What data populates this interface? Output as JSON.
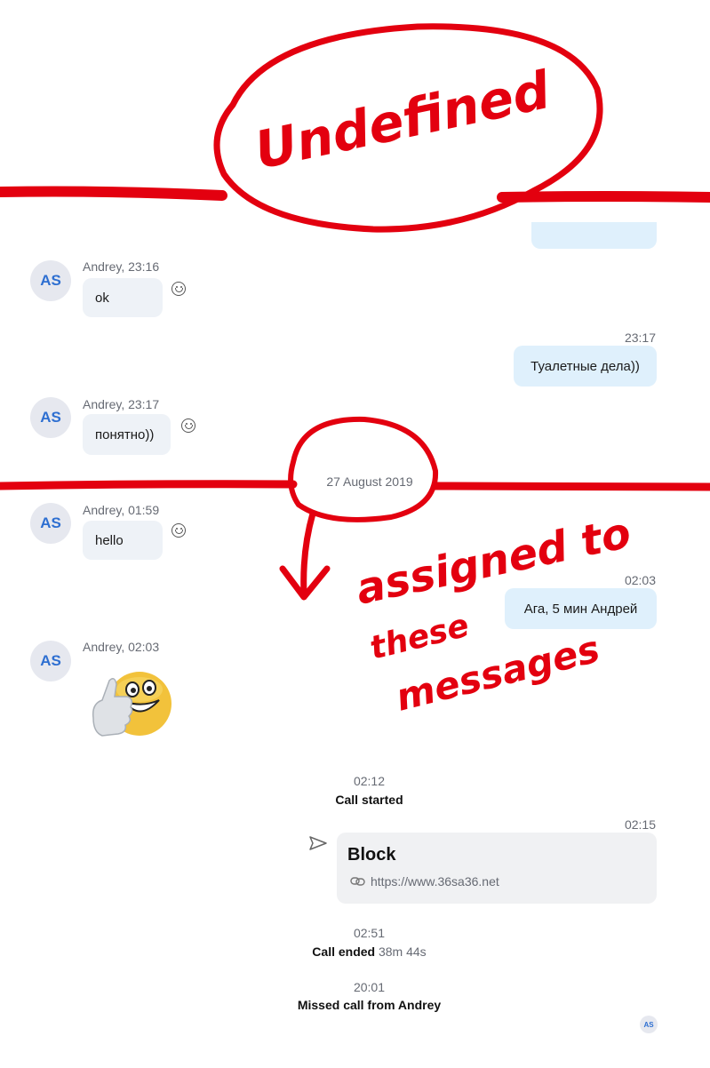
{
  "annotations": {
    "top_label": "Undefined",
    "arrow_label": "assigned to these messages"
  },
  "messages": {
    "m1": {
      "sender_initials": "AS",
      "meta": "Andrey, 23:16",
      "text": "ok"
    },
    "m2": {
      "time": "23:17",
      "text": "Туалетные дела))"
    },
    "m3": {
      "sender_initials": "AS",
      "meta": "Andrey, 23:17",
      "text": "понятно))"
    },
    "date_divider": "27 August 2019",
    "m4": {
      "sender_initials": "AS",
      "meta": "Andrey, 01:59",
      "text": "hello"
    },
    "m5": {
      "time": "02:03",
      "text": "Ага, 5 мин Андрей"
    },
    "m6": {
      "sender_initials": "AS",
      "meta": "Andrey, 02:03",
      "emoji": "thumbs-up-emoticon"
    },
    "call_start": {
      "time": "02:12",
      "label": "Call started"
    },
    "card": {
      "time": "02:15",
      "title": "Block",
      "url": "https://www.36sa36.net"
    },
    "call_end": {
      "time": "02:51",
      "label": "Call ended",
      "duration": "38m 44s"
    },
    "missed": {
      "time": "20:01",
      "label": "Missed call from Andrey"
    },
    "read_receipt_initials": "AS"
  },
  "colors": {
    "annotation": "#e3000f",
    "avatar_text": "#2e6fd1",
    "outgoing_bubble": "#dff0fc",
    "incoming_bubble": "#eef2f7"
  }
}
